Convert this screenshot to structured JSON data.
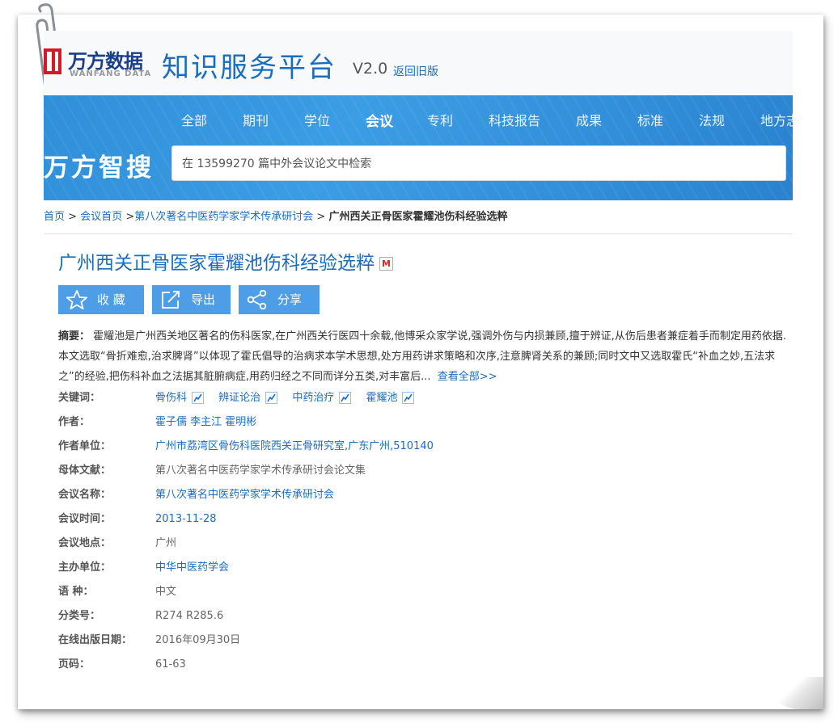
{
  "header": {
    "logo_cn": "万方数据",
    "logo_en": "WANFANG DATA",
    "platform": "知识服务平台",
    "version": "V2.0",
    "old_version_link": "返回旧版"
  },
  "nav": {
    "items": [
      {
        "label": "全部"
      },
      {
        "label": "期刊"
      },
      {
        "label": "学位"
      },
      {
        "label": "会议",
        "active": true
      },
      {
        "label": "专利"
      },
      {
        "label": "科技报告"
      },
      {
        "label": "成果"
      },
      {
        "label": "标准"
      },
      {
        "label": "法规"
      },
      {
        "label": "地方志"
      }
    ]
  },
  "search": {
    "brand": "万方智搜",
    "placeholder": "在 13599270 篇中外会议论文中检索"
  },
  "breadcrumb": {
    "home": "首页",
    "sep": ">",
    "conf_home": "会议首页",
    "conference": "第八次著名中医药学家学术传承研讨会",
    "current": "广州西关正骨医家霍耀池伤科经验选粹"
  },
  "paper": {
    "title": "广州西关正骨医家霍耀池伤科经验选粹",
    "badge": "M"
  },
  "actions": {
    "collect": "收 藏",
    "export": "导出",
    "share": "分享"
  },
  "abstract": {
    "label": "摘要：",
    "text": "霍耀池是广州西关地区著名的伤科医家,在广州西关行医四十余载,他博采众家学说,强调外伤与内损兼顾,擅于辨证,从伤后患者兼症着手而制定用药依据.本文选取“骨折难愈,治求脾肾”以体现了霍氏倡导的治病求本学术思想,处方用药讲求策略和次序,注意脾肾关系的兼顾;同时文中又选取霍氏“补血之妙,五法求之”的经验,把伤科补血之法据其脏腑病症,用药归经之不同而详分五类,对丰富后...",
    "more": "查看全部>>"
  },
  "details": {
    "keywords_label": "关键词：",
    "keywords": [
      "骨伤科",
      "辨证论治",
      "中药治疗",
      "霍耀池"
    ],
    "authors_label": "作者：",
    "authors": "霍子儒 李主江 霍明彬",
    "affiliation_label": "作者单位：",
    "affiliation": "广州市荔湾区骨伤科医院西关正骨研究室,广东广州,510140",
    "source_label": "母体文献：",
    "source": "第八次著名中医药学家学术传承研讨会论文集",
    "conf_name_label": "会议名称：",
    "conf_name": "第八次著名中医药学家学术传承研讨会",
    "conf_date_label": "会议时间：",
    "conf_date": "2013-11-28",
    "conf_place_label": "会议地点：",
    "conf_place": "广州",
    "organizer_label": "主办单位：",
    "organizer": "中华中医药学会",
    "language_label": "语 种：",
    "language": "中文",
    "class_label": "分类号：",
    "class_no": "R274 R285.6",
    "online_date_label": "在线出版日期：",
    "online_date": "2016年09月30日",
    "pages_label": "页码：",
    "pages": "61-63"
  }
}
